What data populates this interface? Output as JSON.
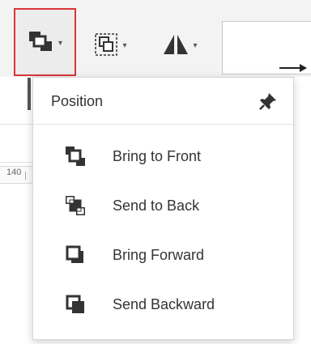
{
  "toolbar": {
    "position_button": {
      "icon": "bring-to-front-icon",
      "selected": true,
      "accent": "#d9353b"
    },
    "group_button": {
      "icon": "group-icon"
    },
    "flip_button": {
      "icon": "flip-icon"
    },
    "caret": "▾"
  },
  "ruler": {
    "label": "140"
  },
  "dropdown": {
    "title": "Position",
    "pin_icon": "pin-icon",
    "items": [
      {
        "label": "Bring to Front",
        "icon": "bring-to-front-icon"
      },
      {
        "label": "Send to Back",
        "icon": "send-to-back-icon"
      },
      {
        "label": "Bring Forward",
        "icon": "bring-forward-icon"
      },
      {
        "label": "Send Backward",
        "icon": "send-backward-icon"
      }
    ]
  }
}
